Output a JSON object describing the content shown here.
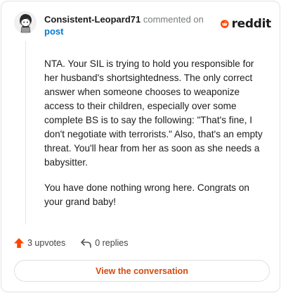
{
  "comment": {
    "username": "Consistent-Leopard71",
    "commented_text": "commented on",
    "post_link": "post",
    "paragraphs": [
      "NTA. Your SIL is trying to hold you responsible for her husband's shortsightedness. The only correct answer when someone chooses to weaponize access to their children, especially over some complete BS is to say the following: \"That's fine, I don't negotiate with terrorists.\" Also, that's an empty threat. You'll hear from her as soon as she needs a babysitter.",
      "You have done nothing wrong here. Congrats on your grand baby!"
    ]
  },
  "brand": {
    "name": "reddit",
    "color": "#ff4500"
  },
  "actions": {
    "upvotes": "3 upvotes",
    "replies": "0 replies"
  },
  "cta": {
    "label": "View the conversation",
    "color": "#d44a0d"
  },
  "icons": {
    "avatar": "avatar-snoo",
    "upvote": "upvote-arrow-icon",
    "reply": "reply-arrow-icon",
    "logo": "reddit-snoo-icon"
  }
}
